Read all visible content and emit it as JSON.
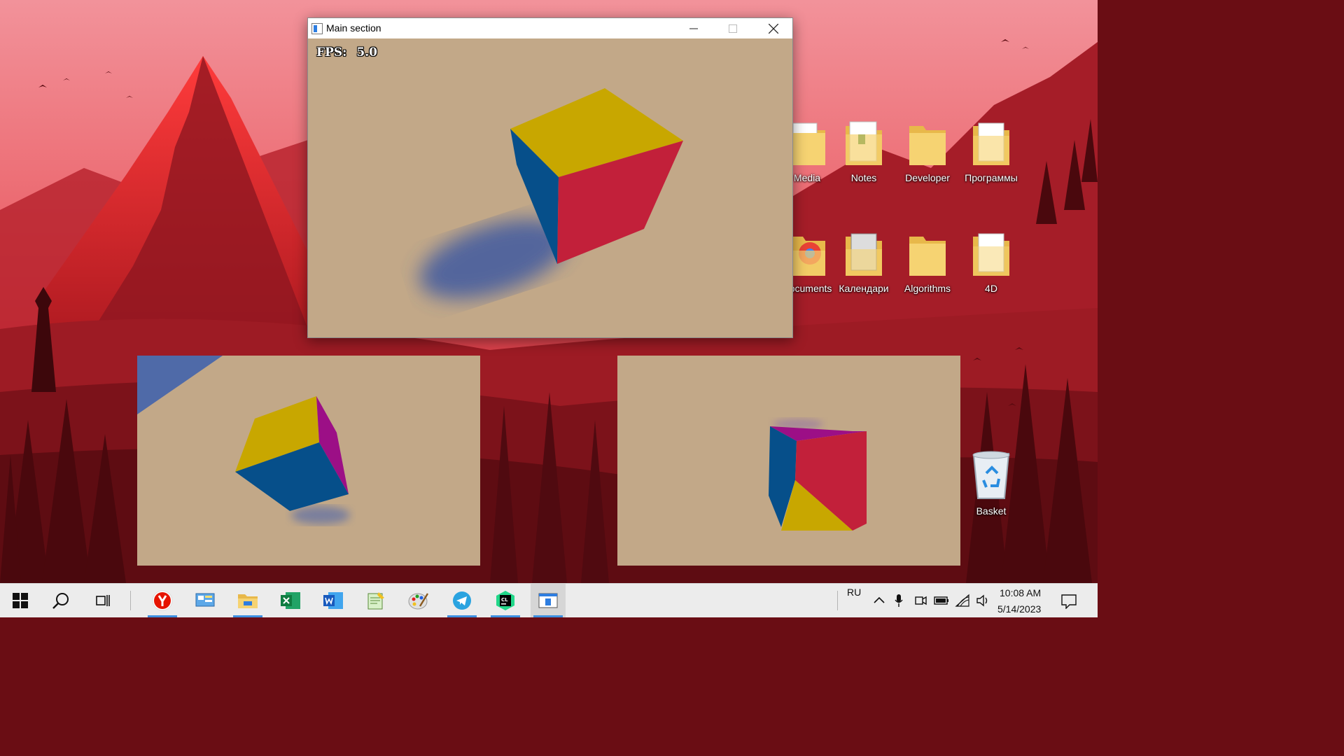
{
  "window": {
    "title": "Main section",
    "fps_label": "FPS:",
    "fps_value": "5.0"
  },
  "desktop": {
    "icons": [
      {
        "label": "Media",
        "icon": "folder-icon"
      },
      {
        "label": "Notes",
        "icon": "folder-icon"
      },
      {
        "label": "Developer",
        "icon": "folder-icon"
      },
      {
        "label": "Программы",
        "icon": "folder-icon"
      },
      {
        "label": "Documents",
        "icon": "folder-icon"
      },
      {
        "label": "Календари",
        "icon": "folder-icon"
      },
      {
        "label": "Algorithms",
        "icon": "folder-icon"
      },
      {
        "label": "4D",
        "icon": "folder-icon"
      },
      {
        "label": "Basket",
        "icon": "recycle-bin-icon"
      }
    ]
  },
  "taskbar": {
    "apps": [
      "windows-start-icon",
      "search-icon",
      "task-view-icon",
      "yandex-browser-icon",
      "control-panel-icon",
      "file-explorer-icon",
      "excel-icon",
      "word-icon",
      "notepad-icon",
      "paint-icon",
      "telegram-icon",
      "clion-icon",
      "main-section-app-icon"
    ],
    "language": "RU",
    "time": "10:08 AM",
    "date": "5/14/2023"
  },
  "colors": {
    "cube_yellow": "#c8a700",
    "cube_red": "#c2203a",
    "cube_blue": "#064f8a",
    "cube_magenta": "#9c0f86",
    "floor": "#c2a888"
  }
}
